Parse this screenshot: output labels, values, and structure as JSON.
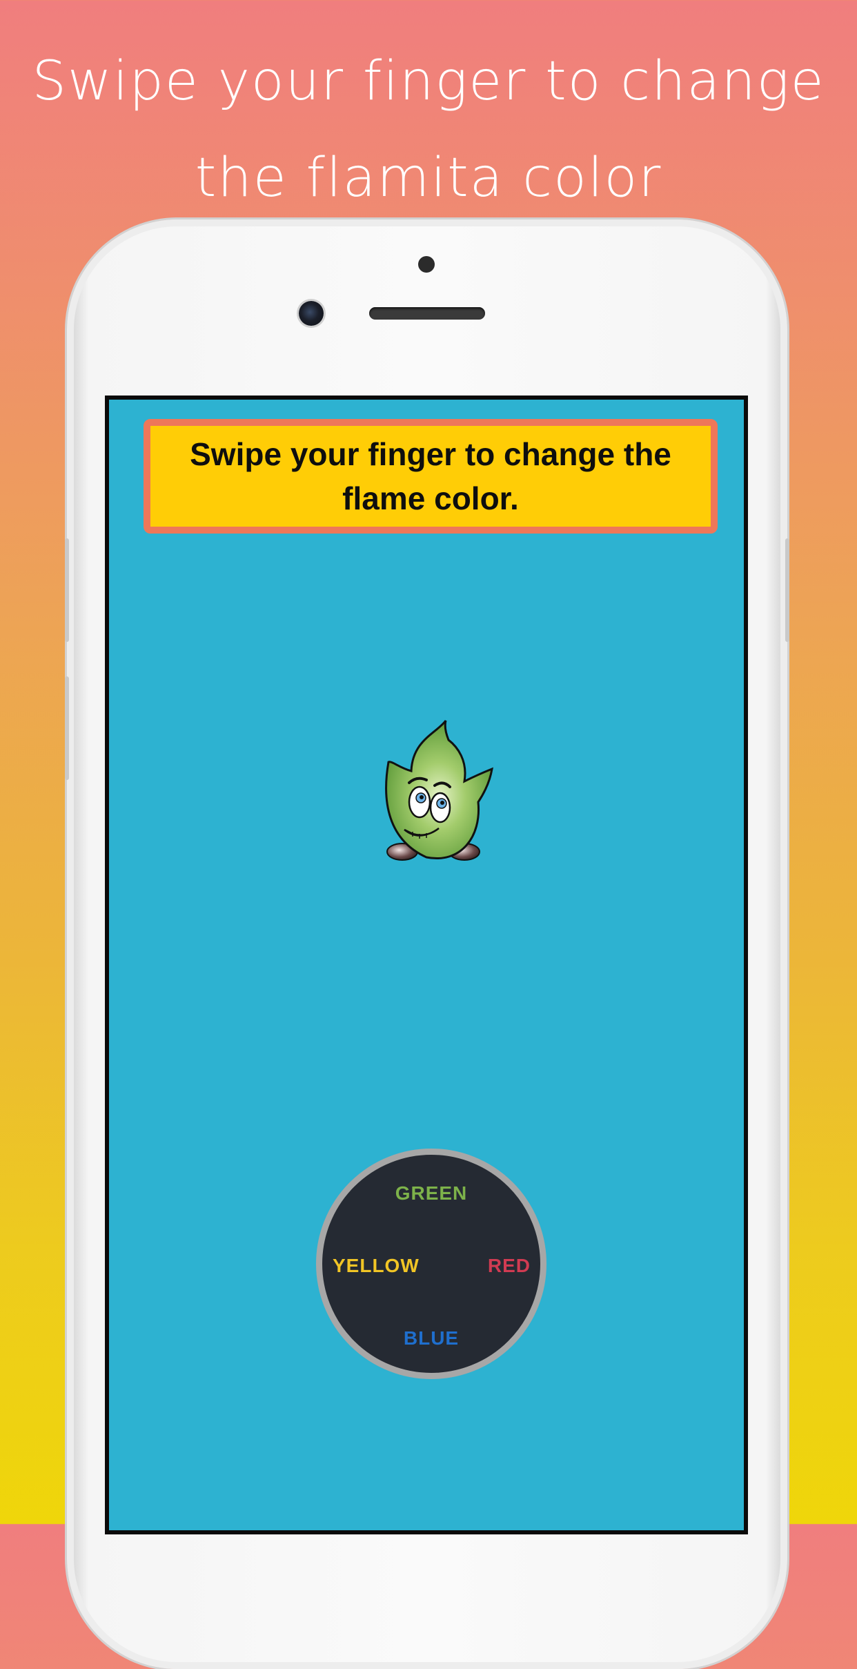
{
  "headline": {
    "line1": "Swipe your finger to change",
    "line2": "the flamita color"
  },
  "app": {
    "instruction_line1": "Swipe your finger to change the",
    "instruction_line2": "flame color.",
    "character": "flamita-green",
    "joystick": {
      "top": "GREEN",
      "left": "YELLOW",
      "right": "RED",
      "bottom": "BLUE"
    }
  },
  "colors": {
    "screen_bg": "#2DB2D1",
    "banner_bg": "#FFCD06",
    "banner_border": "#EE7759",
    "joystick_bg": "#252A33",
    "green": "#7DB24A",
    "yellow": "#F1C525",
    "red": "#D13B52",
    "blue": "#1F6FCE"
  }
}
